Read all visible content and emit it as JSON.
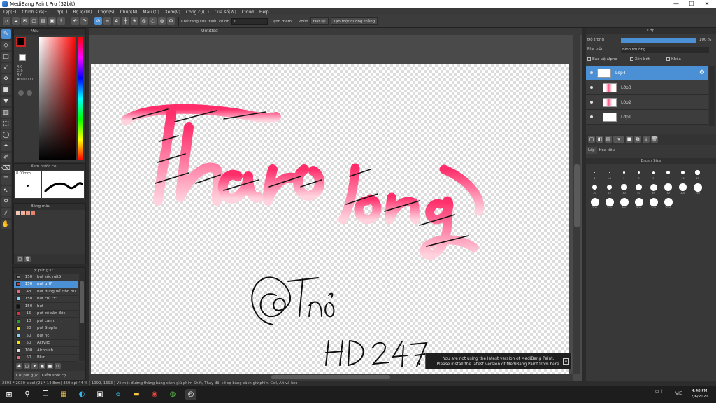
{
  "window": {
    "title": "MediBang Paint Pro (32bit)",
    "minimize": "—",
    "maximize": "☐",
    "close": "✕"
  },
  "menu": [
    "Tệp(F)",
    "Chỉnh sửa(E)",
    "Lớp(L)",
    "Bộ lọc(R)",
    "Chọn(S)",
    "Chụp(N)",
    "Màu (C)",
    "Xem(V)",
    "Công cụ(T)",
    "Cửa sổ(W)",
    "Cloud",
    "Help"
  ],
  "toolbar": {
    "correction_label": "Khử răng cưa",
    "adjust_label": "Điều chỉnh",
    "adjust_value": "1",
    "edge_label": "Cạnh mềm",
    "key_label": "Phím",
    "cancel_label": "Đặt lại",
    "straight_label": "Tạo một đường thẳng"
  },
  "canvas": {
    "tab_title": "Untitled"
  },
  "color_panel": {
    "title": "Màu",
    "r": "R 0",
    "g": "G 0",
    "b": "B 0",
    "hex": "#000000"
  },
  "preview_panel": {
    "title": "Xem trước cọ",
    "size": "8.00mm"
  },
  "palette_panel": {
    "title": "Bảng màu"
  },
  "brush_panel": {
    "title": "Cọ: pút g:)?",
    "items": [
      {
        "size": "150",
        "name": "bút sốc nét5",
        "color": "#888888"
      },
      {
        "size": "150",
        "name": "pút g:)?",
        "color": "#e0303a"
      },
      {
        "size": "43",
        "name": "bút dùng để tròn mi",
        "color": "#e86a78"
      },
      {
        "size": "150",
        "name": "bút chì \"*\"",
        "color": "#7fd4f5"
      },
      {
        "size": "150",
        "name": "bút",
        "color": "#111111"
      },
      {
        "size": "15",
        "name": "pút zế cần đốc)",
        "color": "#e0303a"
      },
      {
        "size": "10",
        "name": "pút cạnh.___.",
        "color": "#23a326"
      },
      {
        "size": "50",
        "name": "pút Stople",
        "color": "#f5e600"
      },
      {
        "size": "50",
        "name": "pút nc",
        "color": "#7fd4f5"
      },
      {
        "size": "50",
        "name": "Acrylic",
        "color": "#f5e600"
      },
      {
        "size": "100",
        "name": "Airbrush",
        "color": "#dddddd"
      },
      {
        "size": "50",
        "name": "Blur",
        "color": "#e86a78"
      }
    ],
    "tab1": "Cọ: pút g:)?",
    "tab2": "Kiểm soát cọ"
  },
  "layer_panel": {
    "title": "Lớp",
    "opacity_label": "Độ trong",
    "opacity_value": "100 %",
    "opacity_fraction": 1.0,
    "blend_label": "Pha trộn",
    "blend_value": "Bình thường",
    "protect_alpha": "Bảo vệ alpha",
    "clipping": "Xén bớt",
    "lock": "Khóa",
    "layers": [
      {
        "name": "Lớp4",
        "selected": true
      },
      {
        "name": "Lớp3",
        "selected": false
      },
      {
        "name": "Lớp2",
        "selected": false
      },
      {
        "name": "Lớp1",
        "selected": false
      }
    ],
    "tab1": "Lớp",
    "tab2": "Hoa tiêu"
  },
  "brush_size_panel": {
    "title": "Brush Size",
    "sizes": [
      "1",
      "1.5",
      "2",
      "3",
      "5",
      "7",
      "10",
      "15",
      "20",
      "25",
      "30",
      "40",
      "50",
      "70",
      "100",
      "150",
      "200",
      "300",
      "400",
      "500",
      "700",
      "1000"
    ]
  },
  "notice": {
    "line1": "You are not using the latest version of MediBang Paint.",
    "line2": "Please install the latest version of MediBang Paint from here."
  },
  "status": "2893 * 2030 pixel  (21 * 14.8cm)  350 dpi  44 %  ( 1999, 1693 )  Vẽ một đường thẳng bằng cách giữ phím Shift, Thay đổi cỡ cọ bằng cách giữ phím Ctrl, Alt và kéo",
  "taskbar": {
    "time": "4:48 PM",
    "date": "7/6/2021",
    "lang": "VIE"
  },
  "artwork": {
    "text1": "@Thỏ",
    "text2": "HD247."
  }
}
